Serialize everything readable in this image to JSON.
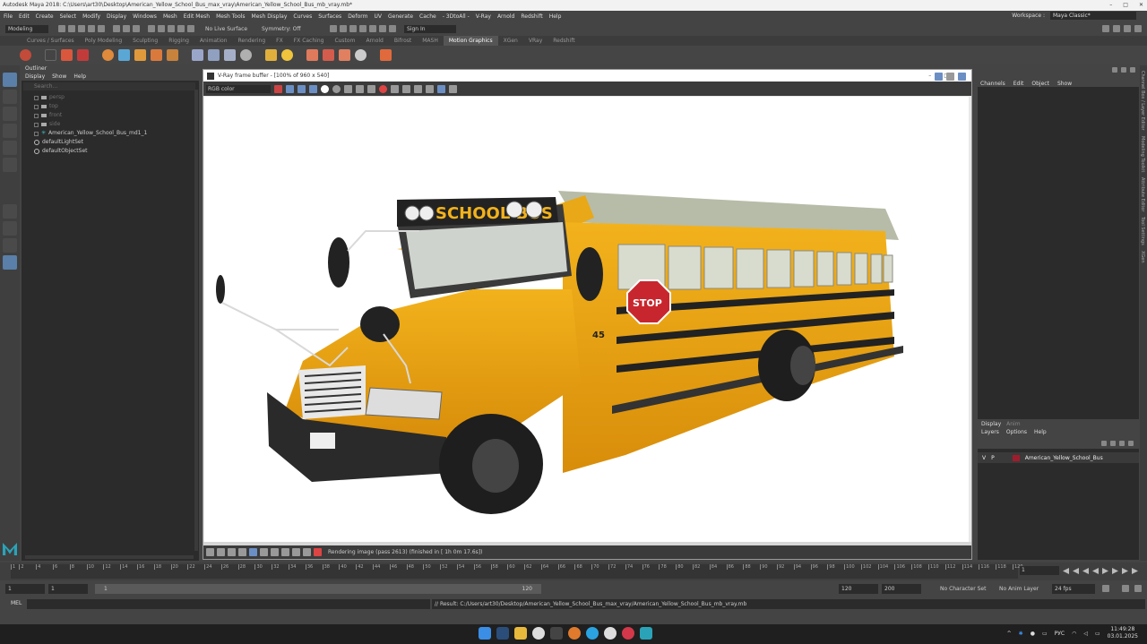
{
  "window_title": "Autodesk Maya 2018: C:\\Users\\art30\\Desktop\\American_Yellow_School_Bus_max_vray\\American_Yellow_School_Bus_mb_vray.mb*",
  "menu": [
    "File",
    "Edit",
    "Create",
    "Select",
    "Modify",
    "Display",
    "Windows",
    "Mesh",
    "Edit Mesh",
    "Mesh Tools",
    "Mesh Display",
    "Curves",
    "Surfaces",
    "Deform",
    "UV",
    "Generate",
    "Cache",
    "- 3DtoAll -",
    "V-Ray",
    "Arnold",
    "Redshift",
    "Help"
  ],
  "workspace": {
    "label": "Workspace :",
    "value": "Maya Classic*"
  },
  "status_line": {
    "mode": "Modeling",
    "live_surface": "No Live Surface",
    "symmetry": "Symmetry: Off",
    "sign_in": "Sign In"
  },
  "shelf_tabs": [
    "Curves / Surfaces",
    "Poly Modeling",
    "Sculpting",
    "Rigging",
    "Animation",
    "Rendering",
    "FX",
    "FX Caching",
    "Custom",
    "Arnold",
    "Bifrost",
    "MASH",
    "Motion Graphics",
    "XGen",
    "VRay",
    "Redshift"
  ],
  "shelf_active": "Motion Graphics",
  "outliner": {
    "title": "Outliner",
    "menu": [
      "Display",
      "Show",
      "Help"
    ],
    "search_placeholder": "Search...",
    "items": [
      {
        "label": "persp",
        "dim": true
      },
      {
        "label": "top",
        "dim": true
      },
      {
        "label": "front",
        "dim": true
      },
      {
        "label": "side",
        "dim": true
      },
      {
        "label": "American_Yellow_School_Bus_md1_1",
        "dim": false
      },
      {
        "label": "defaultLightSet",
        "dim": false
      },
      {
        "label": "defaultObjectSet",
        "dim": false
      }
    ]
  },
  "vfb": {
    "title": "V-Ray frame buffer - [100% of 960 x 540]",
    "channel": "RGB color",
    "status": "Rendering image (pass 2613) (finished in [ 1h 0m 17.6s])"
  },
  "render": {
    "sign_text": "SCHOOL BUS",
    "stop_text": "STOP",
    "bus_number": "45"
  },
  "channel_box": {
    "menu": [
      "Channels",
      "Edit",
      "Object",
      "Show"
    ]
  },
  "layer_editor": {
    "tabs": [
      "Display",
      "Anim"
    ],
    "menu": [
      "Layers",
      "Options",
      "Help"
    ],
    "layer": {
      "v": "V",
      "p": "P",
      "name": "American_Yellow_School_Bus"
    }
  },
  "side_tabs": [
    "Channel Box / Layer Editor",
    "Modeling Toolkit",
    "Attribute Editor",
    "Tool Settings",
    "XGen"
  ],
  "timeline": {
    "ticks": [
      1,
      2,
      4,
      6,
      8,
      10,
      12,
      14,
      16,
      18,
      20,
      22,
      24,
      26,
      28,
      30,
      32,
      34,
      36,
      38,
      40,
      42,
      44,
      46,
      48,
      50,
      52,
      54,
      56,
      58,
      60,
      62,
      64,
      66,
      68,
      70,
      72,
      74,
      76,
      78,
      80,
      82,
      84,
      86,
      88,
      90,
      92,
      94,
      96,
      98,
      100,
      102,
      104,
      106,
      108,
      110,
      112,
      114,
      116,
      118,
      120
    ],
    "current_frame": "1"
  },
  "range": {
    "start": "1",
    "inner_start": "1",
    "slider_start": "1",
    "slider_end": "120",
    "end": "120",
    "outer_end": "200",
    "character_set": "No Character Set",
    "anim_layer": "No Anim Layer",
    "fps": "24 fps"
  },
  "command": {
    "lang": "MEL",
    "result": "// Result: C:/Users/art30/Desktop/American_Yellow_School_Bus_max_vray/American_Yellow_School_Bus_mb_vray.mb"
  },
  "taskbar": {
    "lang": "РУС",
    "time": "11:49:28",
    "date": "03.01.2025"
  }
}
